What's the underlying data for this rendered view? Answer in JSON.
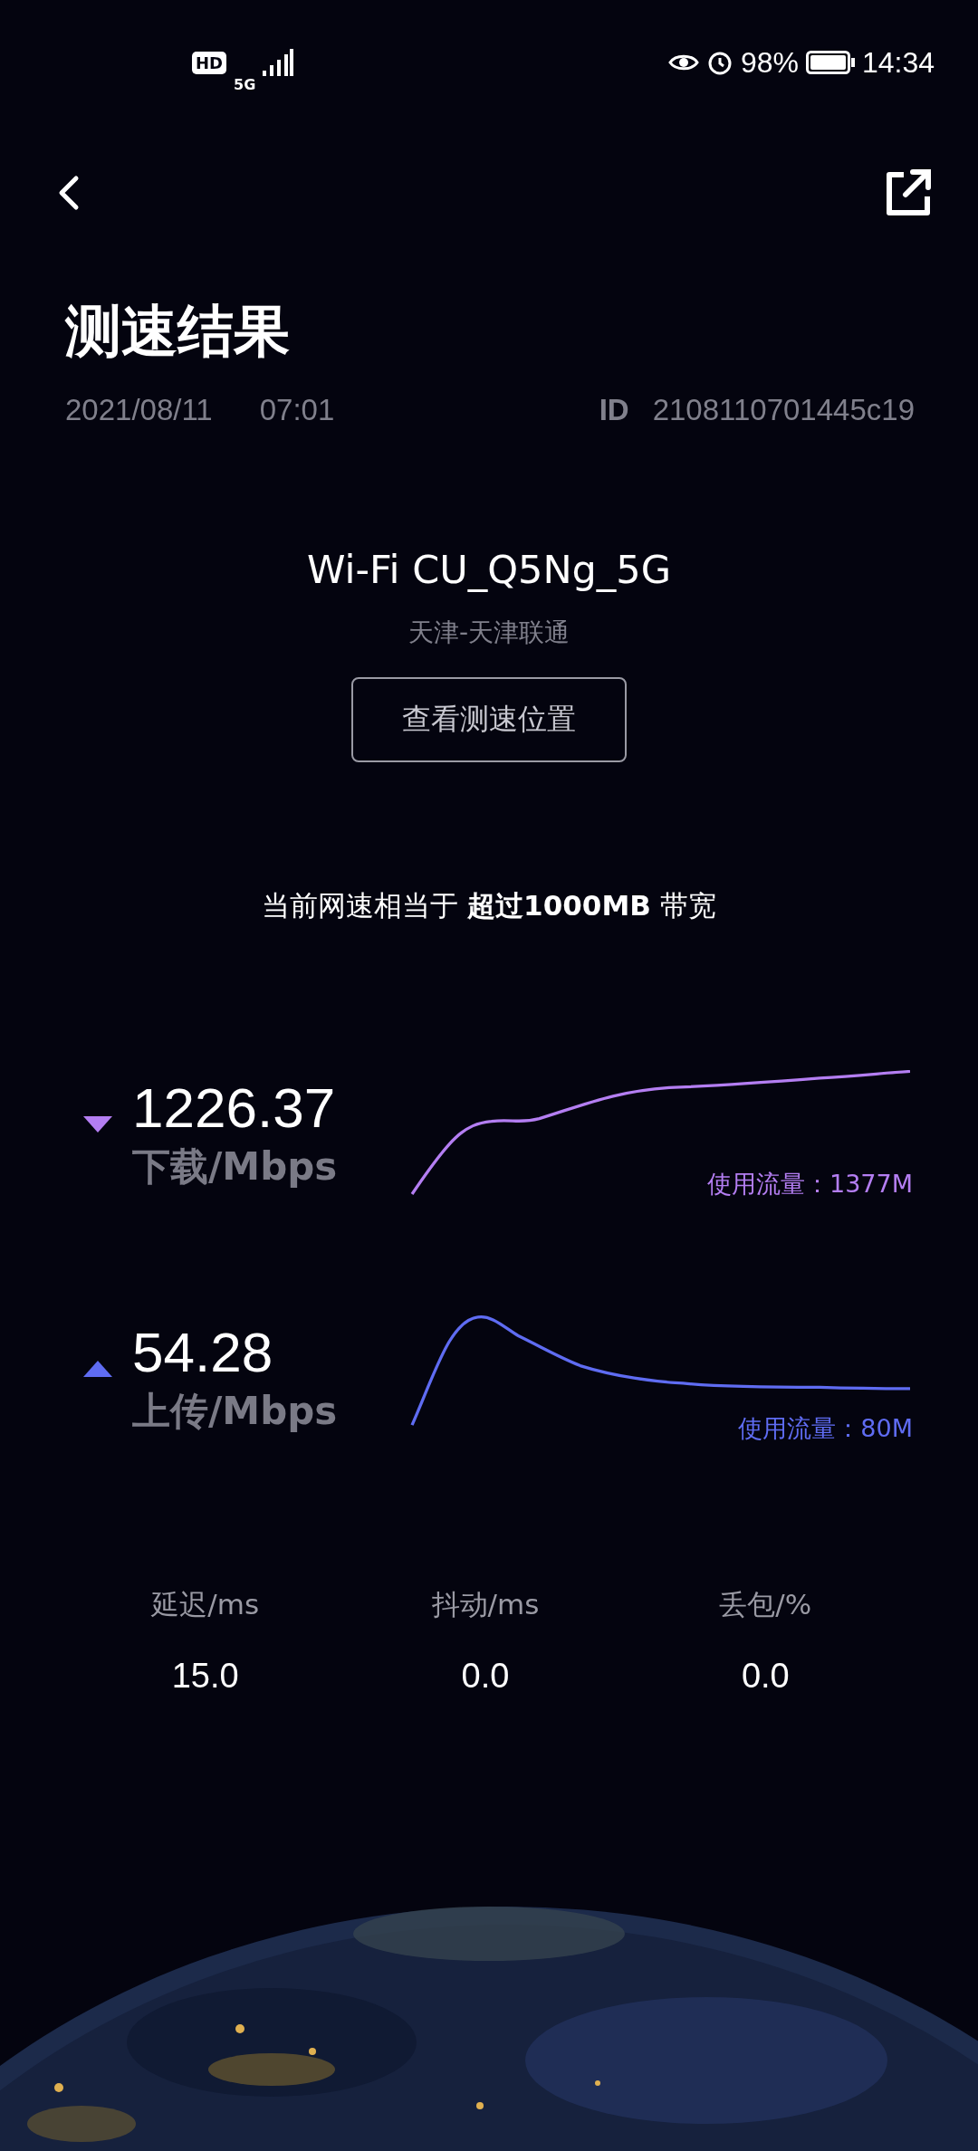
{
  "status_bar": {
    "hd_badge": "HD",
    "network": "5G",
    "battery": "98%",
    "time": "14:34"
  },
  "title": "测速结果",
  "meta": {
    "date": "2021/08/11",
    "time": "07:01",
    "id_label": "ID",
    "id": "2108110701445c19"
  },
  "network": {
    "name": "Wi-Fi CU_Q5Ng_5G",
    "provider": "天津-天津联通",
    "location_button": "查看测速位置"
  },
  "summary": "当前网速相当于 **超过1000MB** 带宽",
  "speeds": [
    {
      "kind": "download",
      "value": "1226.37",
      "unit": "下载/Mbps",
      "usage": "使用流量：1377M",
      "color": "#b47ef2"
    },
    {
      "kind": "upload",
      "value": "54.28",
      "unit": "上传/Mbps",
      "usage": "使用流量：80M",
      "color": "#5f6cf2"
    }
  ],
  "metrics": [
    {
      "label": "延迟/ms",
      "value": "15.0"
    },
    {
      "label": "抖动/ms",
      "value": "0.0"
    },
    {
      "label": "丢包/%",
      "value": "0.0"
    }
  ]
}
